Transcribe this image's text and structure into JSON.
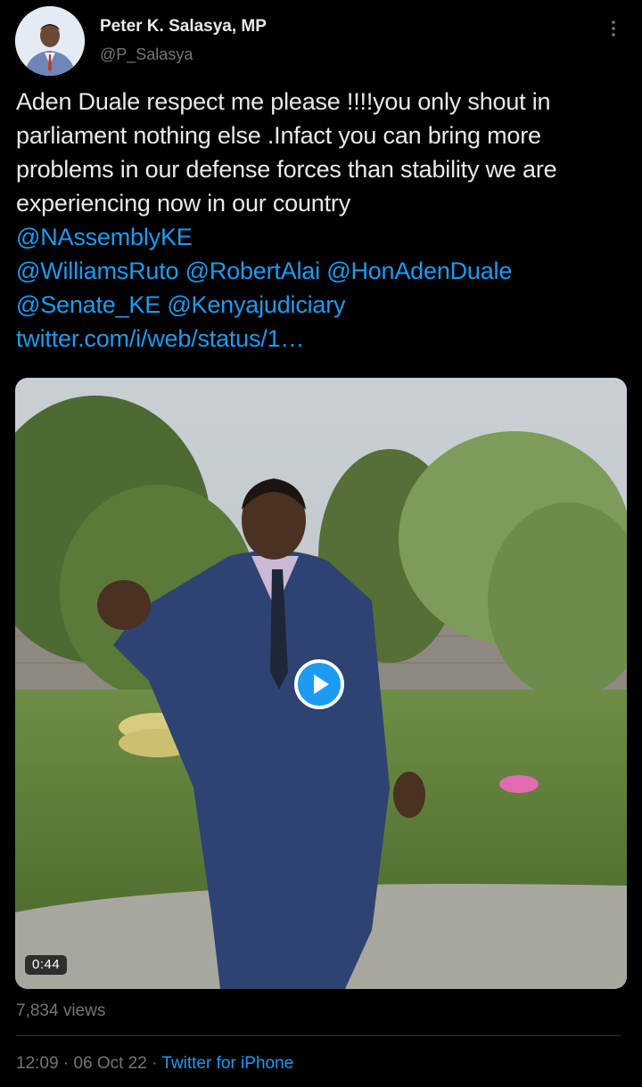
{
  "tweet": {
    "display_name": "Peter K. Salasya, MP",
    "handle": "@P_Salasya",
    "text_parts": [
      "Aden Duale respect me please !!!!you only shout in parliament nothing else .Infact you can bring more problems in our defense forces than stability we are experiencing now in our country "
    ],
    "mentions": {
      "m1": "@NAssemblyKE",
      "m2": "@WilliamsRuto",
      "m3": "@RobertAlai",
      "m4": "@HonAdenDuale",
      "m5": "@Senate_KE",
      "m6": "@Kenyajudiciary",
      "url": "twitter.com/i/web/status/1…"
    }
  },
  "media": {
    "duration": "0:44",
    "play_icon": "play-icon"
  },
  "stats": {
    "views": "7,834 views"
  },
  "meta": {
    "time": "12:09",
    "sep1": " · ",
    "date": "06 Oct 22",
    "sep2": " · ",
    "source": "Twitter for iPhone"
  },
  "colors": {
    "background": "#000000",
    "text": "#e7e9ea",
    "muted": "#71767b",
    "link": "#1d9bf0",
    "divider": "#2f3336"
  }
}
